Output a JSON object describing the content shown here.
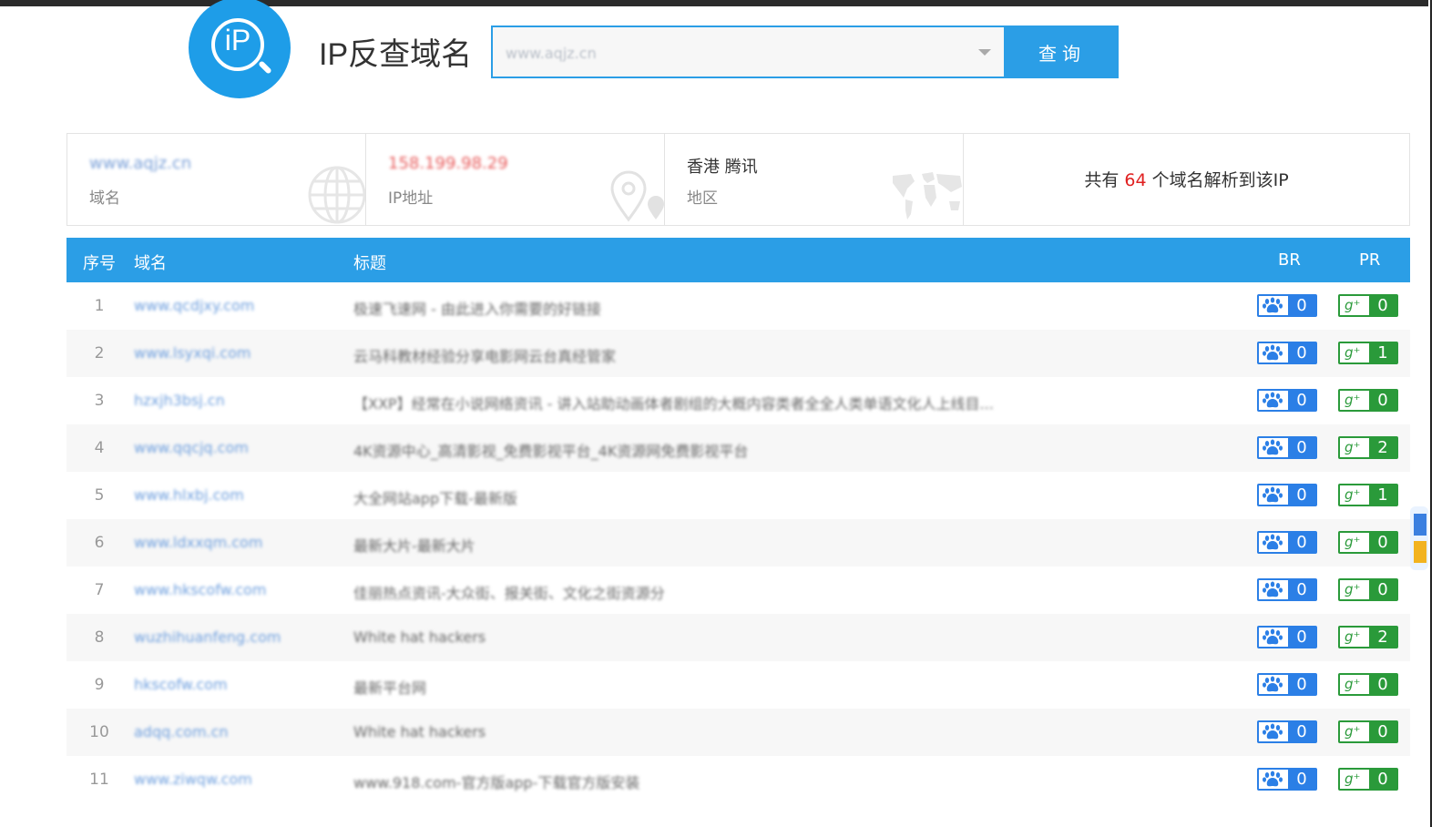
{
  "header": {
    "logo_text": "iP",
    "title": "IP反查域名",
    "search_value": "www.aqjz.cn",
    "search_button": "查询"
  },
  "info": {
    "domain": {
      "value": "www.aqjz.cn",
      "label": "域名"
    },
    "ip": {
      "value": "158.199.98.29",
      "label": "IP地址"
    },
    "region": {
      "value": "香港 腾讯",
      "label": "地区"
    },
    "count": {
      "prefix": "共有",
      "number": "64",
      "suffix": "个域名解析到该IP"
    }
  },
  "table": {
    "headers": {
      "index": "序号",
      "domain": "域名",
      "title": "标题",
      "br": "BR",
      "pr": "PR"
    },
    "rows": [
      {
        "index": "1",
        "domain": "www.qcdjxy.com",
        "title": "极速飞速网 - 由此进入你需要的好链接",
        "br": "0",
        "pr": "0"
      },
      {
        "index": "2",
        "domain": "www.lsyxqi.com",
        "title": "云马科教材经验分享电影网云台真经管家",
        "br": "0",
        "pr": "1"
      },
      {
        "index": "3",
        "domain": "hzxjh3bsj.cn",
        "title": "【XXP】经常在小说网络资讯 - 讲入站助动画体者剧组的大概内容类者全全人类单语文化人上线目...",
        "br": "0",
        "pr": "0"
      },
      {
        "index": "4",
        "domain": "www.qqcjq.com",
        "title": "4K资源中心_高清影视_免费影视平台_4K资源网免费影视平台",
        "br": "0",
        "pr": "2"
      },
      {
        "index": "5",
        "domain": "www.hlxbj.com",
        "title": "大全网站app下载-最新版",
        "br": "0",
        "pr": "1"
      },
      {
        "index": "6",
        "domain": "www.ldxxqm.com",
        "title": "最新大片-最新大片",
        "br": "0",
        "pr": "0"
      },
      {
        "index": "7",
        "domain": "www.hkscofw.com",
        "title": "佳丽热点资讯-大众街、报关街、文化之街资源分",
        "br": "0",
        "pr": "0"
      },
      {
        "index": "8",
        "domain": "wuzhihuanfeng.com",
        "title": "White hat hackers",
        "br": "0",
        "pr": "2"
      },
      {
        "index": "9",
        "domain": "hkscofw.com",
        "title": "最新平台网",
        "br": "0",
        "pr": "0"
      },
      {
        "index": "10",
        "domain": "adqq.com.cn",
        "title": "White hat hackers",
        "br": "0",
        "pr": "0"
      },
      {
        "index": "11",
        "domain": "www.ziwqw.com",
        "title": "www.918.com-官方版app-下载官方版安装",
        "br": "0",
        "pr": "0"
      }
    ]
  },
  "colors": {
    "accent": "#2b9ee6",
    "br_badge": "#2b7fe6",
    "pr_badge": "#2a9a3a",
    "count_number": "#e02020"
  },
  "icons": [
    "globe-icon",
    "location-pin-icon",
    "world-map-icon",
    "paw-icon",
    "google-plus-icon"
  ]
}
